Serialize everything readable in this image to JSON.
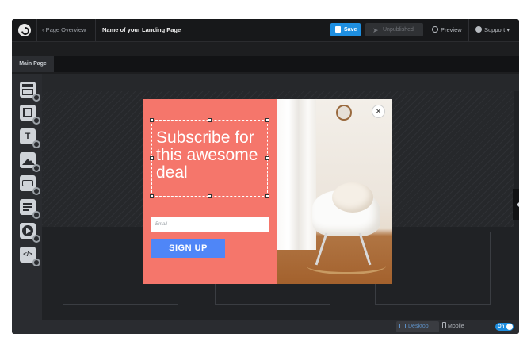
{
  "topbar": {
    "back_label": "‹ Page Overview",
    "page_name": "Name of your Landing Page",
    "save_label": "Save",
    "unpublished_label": "Unpublished",
    "preview_label": "Preview",
    "support_label": "Support ▾"
  },
  "tabs": {
    "main_page": "Main Page"
  },
  "sidebar": {
    "items": [
      {
        "icon": "section-icon"
      },
      {
        "icon": "box-icon"
      },
      {
        "icon": "text-icon",
        "glyph": "T"
      },
      {
        "icon": "image-icon"
      },
      {
        "icon": "button-icon"
      },
      {
        "icon": "form-icon"
      },
      {
        "icon": "video-icon"
      },
      {
        "icon": "code-icon",
        "glyph": "</>"
      }
    ]
  },
  "popup": {
    "headline": "Subscribe for this awesome deal",
    "email_placeholder": "Email",
    "signup_label": "SIGN UP",
    "close_glyph": "×"
  },
  "bottombar": {
    "desktop_label": "Desktop",
    "mobile_label": "Mobile",
    "toggle_label": "On",
    "help_glyph": "?"
  },
  "colors": {
    "popup_bg": "#f5766b",
    "signup_bg": "#4f86f7",
    "accent": "#1e8fe1"
  }
}
